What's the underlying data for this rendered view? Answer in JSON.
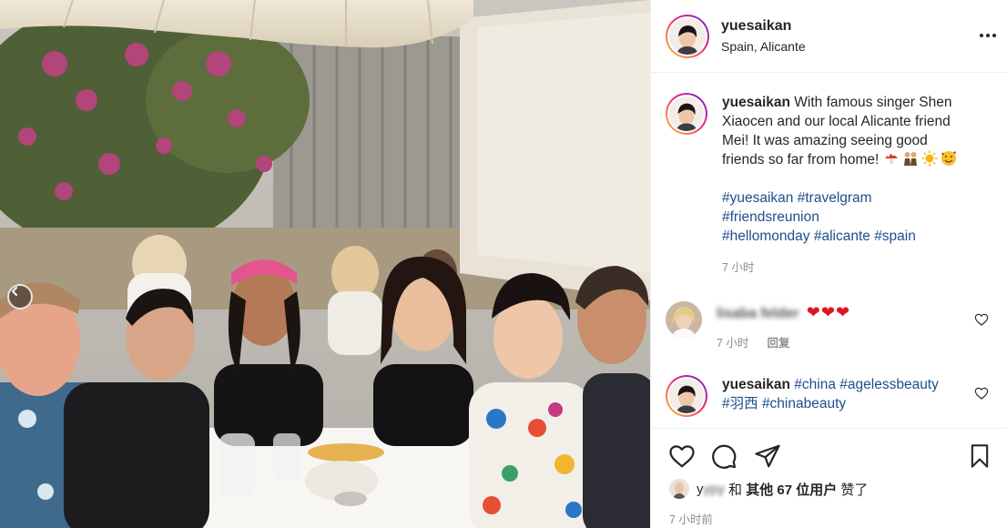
{
  "post": {
    "username": "yuesaikan",
    "location": "Spain, Alicante"
  },
  "icons": {
    "more": "more-options-icon",
    "carousel_prev": "chevron-left-icon",
    "like": "heart-icon",
    "comment": "speech-bubble-icon",
    "share": "paper-plane-icon",
    "save": "bookmark-icon"
  },
  "caption": {
    "username": "yuesaikan",
    "text": "With famous singer Shen Xiaocen and our local Alicante friend Mei! It was amazing seeing good friends so far from home!",
    "emojis": [
      "mushroom-emoji",
      "two-women-emoji",
      "sun-emoji",
      "smiling-hearts-emoji"
    ],
    "hashtags_line1": [
      "#yuesaikan",
      "#travelgram"
    ],
    "hashtags_line2": [
      "#friendsreunion"
    ],
    "hashtags_line3": [
      "#hellomonday",
      "#alicante",
      "#spain"
    ],
    "time": "7 小时"
  },
  "comments": [
    {
      "username": "lisaba",
      "username_suffix": "felder",
      "hearts": "❤❤❤",
      "time": "7 小时",
      "reply": "回复"
    },
    {
      "username": "yuesaikan",
      "hashtags_line1": [
        "#china",
        "#agelessbeauty"
      ],
      "hashtags_line2": [
        "#羽西",
        "#chinabeauty"
      ]
    }
  ],
  "likes": {
    "liker_prefix": "y",
    "liker_rest": "ypy",
    "conjunction": "和",
    "others": "其他 67 位用户",
    "suffix": "赞了"
  },
  "timestamp": "7 小时前",
  "colors": {
    "hashtag": "#1f4e8d",
    "secondary_text": "#8e8e8e",
    "heart_red": "#e0141e",
    "border": "#efefef"
  }
}
